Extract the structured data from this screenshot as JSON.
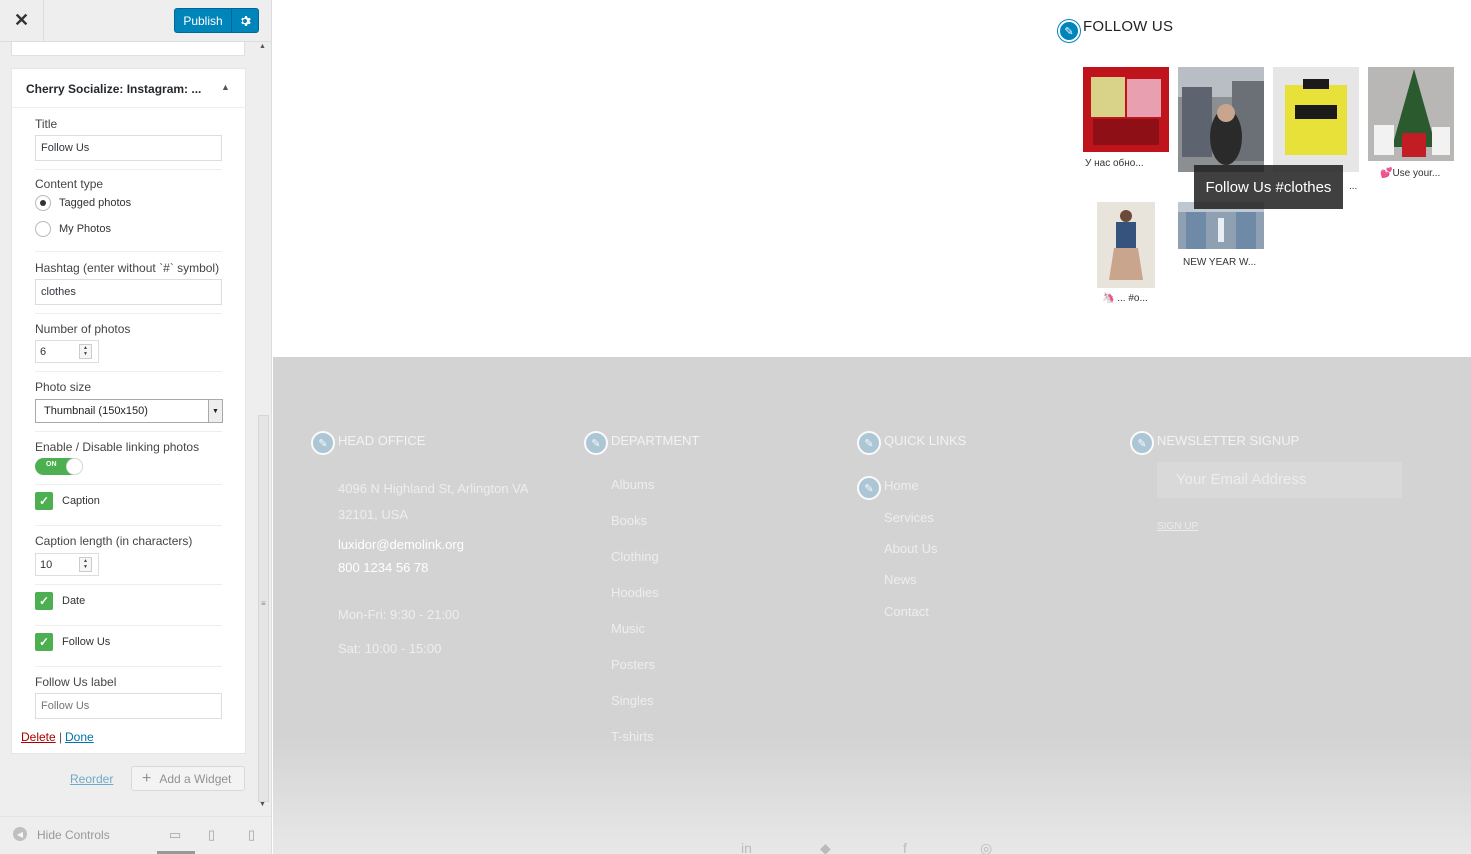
{
  "header": {
    "close_label": "✕",
    "publish_label": "Publish",
    "settings_icon": "gear-icon"
  },
  "widget": {
    "title": "Cherry Socialize: Instagram: ...",
    "toggle_icon": "▲",
    "fields": {
      "title_label": "Title",
      "title_value": "Follow Us",
      "content_type_label": "Content type",
      "content_type_options": [
        "Tagged photos",
        "My Photos"
      ],
      "content_type_selected": "Tagged photos",
      "hashtag_label": "Hashtag (enter without `#` symbol)",
      "hashtag_value": "clothes",
      "num_photos_label": "Number of photos",
      "num_photos_value": "6",
      "photo_size_label": "Photo size",
      "photo_size_value": "Thumbnail (150x150)",
      "linking_label": "Enable / Disable linking photos",
      "linking_toggle_text": "ON",
      "linking_on": true,
      "caption_label": "Caption",
      "caption_checked": true,
      "caption_length_label": "Caption length (in characters)",
      "caption_length_value": "10",
      "date_label": "Date",
      "date_checked": true,
      "follow_us_label": "Follow Us",
      "follow_us_checked": true,
      "follow_us_label_label": "Follow Us label",
      "follow_us_label_placeholder": "Follow Us"
    },
    "delete_label": "Delete",
    "separator": "|",
    "done_label": "Done"
  },
  "panel_actions": {
    "reorder_label": "Reorder",
    "add_widget_label": "Add a Widget"
  },
  "footer_controls": {
    "hide_controls_label": "Hide Controls",
    "devices": [
      "desktop-icon",
      "tablet-icon",
      "mobile-icon"
    ]
  },
  "preview": {
    "follow_title": "FOLLOW US",
    "instagram": [
      {
        "caption": "У нас обно...",
        "colors": [
          "#c0141c",
          "#e8a0b0",
          "#d9d38a"
        ]
      },
      {
        "caption": "",
        "colors": [
          "#5d6470",
          "#8c8f92",
          "#2a2a2a"
        ]
      },
      {
        "caption": "...",
        "colors": [
          "#e7e13a",
          "#1b1b1b",
          "#e6e6e6"
        ]
      },
      {
        "caption": "💕Use your...",
        "colors": [
          "#b8b7b5",
          "#c21d24",
          "#2b5a2f"
        ]
      },
      {
        "caption": "🦄 ... #o...",
        "colors": [
          "#e8e4dc",
          "#35537c",
          "#c9a58d"
        ]
      },
      {
        "caption": "NEW YEAR W...",
        "colors": [
          "#8fa0b2",
          "#6f8aa6",
          "#bfc8d1"
        ]
      }
    ],
    "tooltip": "Follow Us #clothes",
    "footer": {
      "head_office": {
        "heading": "HEAD OFFICE",
        "address_line1": "4096 N Highland St, Arlington VA",
        "address_line2": "32101, USA",
        "email": "luxidor@demolink.org",
        "phone": "800 1234 56 78",
        "hours1": "Mon-Fri: 9:30 - 21:00",
        "hours2": "Sat: 10:00 - 15:00"
      },
      "department": {
        "heading": "DEPARTMENT",
        "links": [
          "Albums",
          "Books",
          "Clothing",
          "Hoodies",
          "Music",
          "Posters",
          "Singles",
          "T-shirts"
        ]
      },
      "quick_links": {
        "heading": "QUICK LINKS",
        "links": [
          "Home",
          "Services",
          "About Us",
          "News",
          "Contact"
        ]
      },
      "newsletter": {
        "heading": "NEWSLETTER SIGNUP",
        "placeholder": "Your Email Address",
        "signup_label": "SIGN UP"
      },
      "social_icons": [
        "linkedin-icon",
        "twitter-icon",
        "facebook-icon",
        "instagram-icon"
      ]
    }
  },
  "colors": {
    "publish_blue": "#0085ba",
    "toggle_green": "#4caf50",
    "footer_gray": "#d3d3d3",
    "delete_red": "#aa0000",
    "link_blue": "#0073aa"
  }
}
